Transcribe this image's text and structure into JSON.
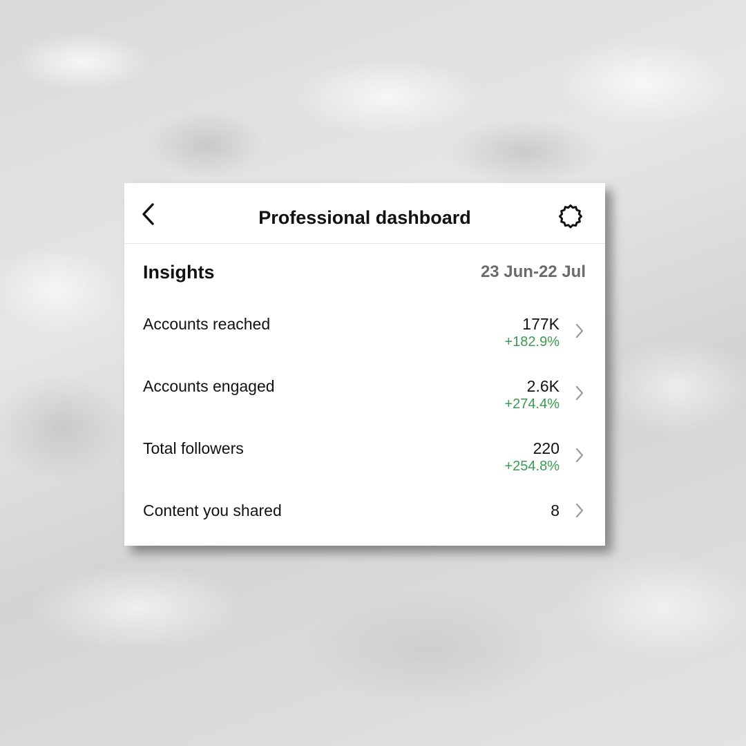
{
  "background": {
    "description_color": "#dcdcdc"
  },
  "header": {
    "title": "Professional dashboard",
    "back_icon": "chevron-left-icon",
    "settings_icon": "gear-icon"
  },
  "insights": {
    "title": "Insights",
    "date_range": "23 Jun-22 Jul"
  },
  "rows": [
    {
      "label": "Accounts reached",
      "value": "177K",
      "change": "+182.9%"
    },
    {
      "label": "Accounts engaged",
      "value": "2.6K",
      "change": "+274.4%"
    },
    {
      "label": "Total followers",
      "value": "220",
      "change": "+254.8%"
    },
    {
      "label": "Content you shared",
      "value": "8",
      "change": ""
    }
  ],
  "colors": {
    "positive_change": "#3a9a4e",
    "muted_text": "#6b6b6b",
    "chevron": "#9a9a9a"
  }
}
